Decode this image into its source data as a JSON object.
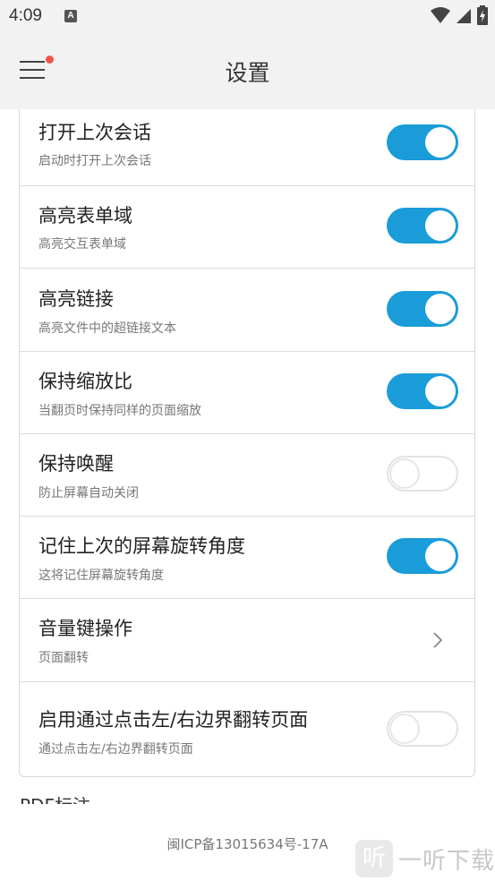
{
  "status_bar": {
    "time": "4:09",
    "notification_icon": "A"
  },
  "toolbar": {
    "title": "设置"
  },
  "settings": [
    {
      "title": "打开上次会话",
      "subtitle": "启动时打开上次会话",
      "control": "toggle",
      "enabled": true
    },
    {
      "title": "高亮表单域",
      "subtitle": "高亮交互表单域",
      "control": "toggle",
      "enabled": true
    },
    {
      "title": "高亮链接",
      "subtitle": "高亮文件中的超链接文本",
      "control": "toggle",
      "enabled": true
    },
    {
      "title": "保持缩放比",
      "subtitle": "当翻页时保持同样的页面缩放",
      "control": "toggle",
      "enabled": true
    },
    {
      "title": "保持唤醒",
      "subtitle": "防止屏幕自动关闭",
      "control": "toggle",
      "enabled": false
    },
    {
      "title": "记住上次的屏幕旋转角度",
      "subtitle": "这将记住屏幕旋转角度",
      "control": "toggle",
      "enabled": true
    },
    {
      "title": "音量键操作",
      "subtitle": "页面翻转",
      "control": "chevron"
    },
    {
      "title": "启用通过点击左/右边界翻转页面",
      "subtitle": "通过点击左/右边界翻转页面",
      "control": "toggle",
      "enabled": false
    }
  ],
  "next_section_title": "PDF标注",
  "footer": {
    "icp": "闽ICP备13015634号-17A",
    "watermark_logo": "听",
    "watermark_text": "一听下载"
  },
  "colors": {
    "accent": "#1a9cd8",
    "notification_dot": "#f0534a",
    "background": "#f2f2f2"
  }
}
